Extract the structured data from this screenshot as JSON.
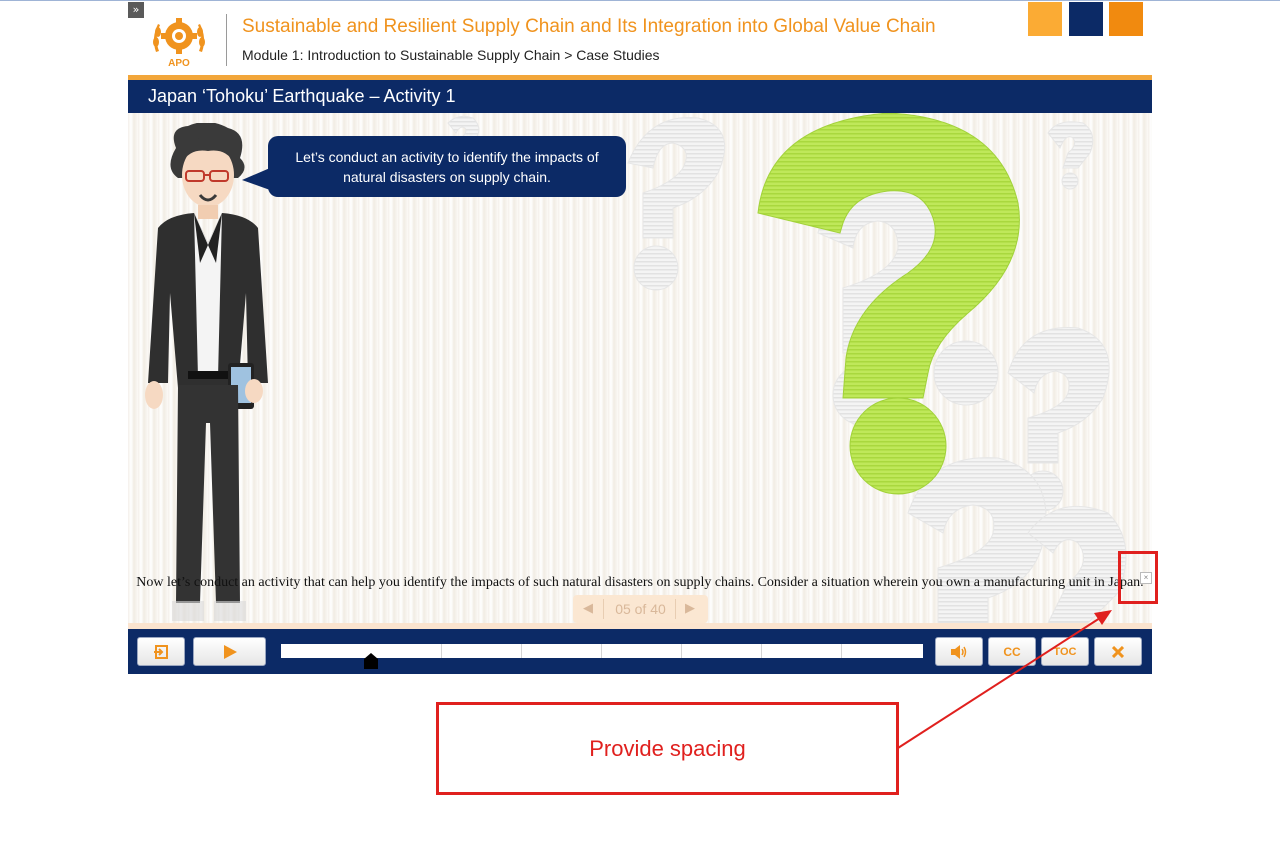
{
  "header": {
    "course_title": "Sustainable and Resilient Supply Chain and Its Integration into Global Value Chain",
    "breadcrumb": "Module 1: Introduction to Sustainable Supply Chain > Case Studies",
    "logo_text": "APO",
    "expand_glyph": "»",
    "decor_colors": [
      "#fbab34",
      "#0c2a66",
      "#f18a0f"
    ]
  },
  "slide": {
    "title": "Japan ‘Tohoku’ Earthquake – Activity 1",
    "bubble_text": "Let’s conduct an activity to identify the impacts of natural disasters on supply chain.",
    "caption": "Now let’s conduct an activity that can help you identify the impacts of such natural disasters on supply chains. Consider a situation wherein you own a manufacturing unit in Japan.",
    "caption_close_glyph": "×"
  },
  "pager": {
    "text": "05 of 40",
    "prev_glyph": "◀",
    "next_glyph": "▶"
  },
  "controls": {
    "exit_icon": "exit-icon",
    "play_icon": "play-icon",
    "audio_icon": "speaker-icon",
    "cc_label": "CC",
    "toc_label": "TOC",
    "close_icon": "close-icon",
    "progress_fraction": 0.14
  },
  "annotation": {
    "text": "Provide spacing",
    "color": "#e0201e"
  },
  "colors": {
    "navy": "#0c2a66",
    "orange": "#f0931e",
    "green": "#b5e34a"
  }
}
